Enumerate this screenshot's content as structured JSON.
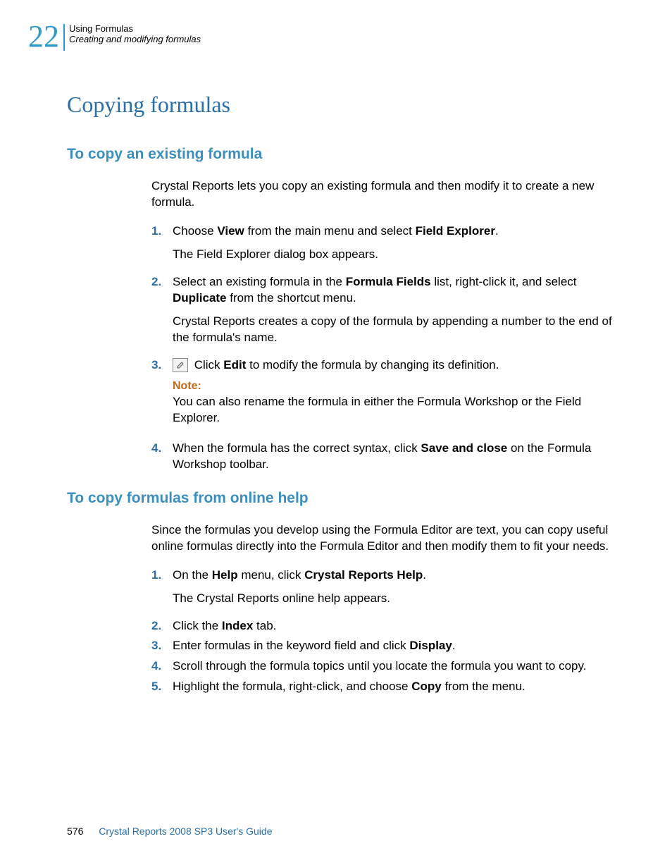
{
  "header": {
    "chapter_number": "22",
    "title": "Using Formulas",
    "subtitle": "Creating and modifying formulas"
  },
  "h1": "Copying formulas",
  "section1": {
    "heading": "To copy an existing formula",
    "intro": "Crystal Reports lets you copy an existing formula and then modify it to create a new formula.",
    "steps": {
      "s1": {
        "num": "1.",
        "pre": "Choose ",
        "b1": "View",
        "mid": " from the main menu and select ",
        "b2": "Field Explorer",
        "post": ".",
        "result": "The Field Explorer dialog box appears."
      },
      "s2": {
        "num": "2.",
        "pre": "Select an existing formula in the ",
        "b1": "Formula Fields",
        "mid": " list, right-click it, and select ",
        "b2": "Duplicate",
        "post": " from the shortcut menu.",
        "result": "Crystal Reports creates a copy of the formula by appending a number to the end of the formula's name."
      },
      "s3": {
        "num": "3.",
        "pre": " Click ",
        "b1": "Edit",
        "post": " to modify the formula by changing its definition.",
        "note_label": "Note:",
        "note_text": "You can also rename the formula in either the Formula Workshop or the Field Explorer."
      },
      "s4": {
        "num": "4.",
        "pre": "When the formula has the correct syntax, click ",
        "b1": "Save and close",
        "post": " on the Formula Workshop toolbar."
      }
    }
  },
  "section2": {
    "heading": "To copy formulas from online help",
    "intro": "Since the formulas you develop using the Formula Editor are text, you can copy useful online formulas directly into the Formula Editor and then modify them to fit your needs.",
    "steps": {
      "s1": {
        "num": "1.",
        "pre": "On the ",
        "b1": "Help",
        "mid": " menu, click ",
        "b2": "Crystal Reports Help",
        "post": ".",
        "result": "The Crystal Reports online help appears."
      },
      "s2": {
        "num": "2.",
        "pre": "Click the ",
        "b1": "Index",
        "post": " tab."
      },
      "s3": {
        "num": "3.",
        "pre": "Enter formulas in the keyword field and click ",
        "b1": "Display",
        "post": "."
      },
      "s4": {
        "num": "4.",
        "text": "Scroll through the formula topics until you locate the formula you want to copy."
      },
      "s5": {
        "num": "5.",
        "pre": "Highlight the formula, right-click, and choose ",
        "b1": "Copy",
        "post": " from the menu."
      }
    }
  },
  "footer": {
    "page": "576",
    "title": "Crystal Reports 2008 SP3 User's Guide"
  }
}
